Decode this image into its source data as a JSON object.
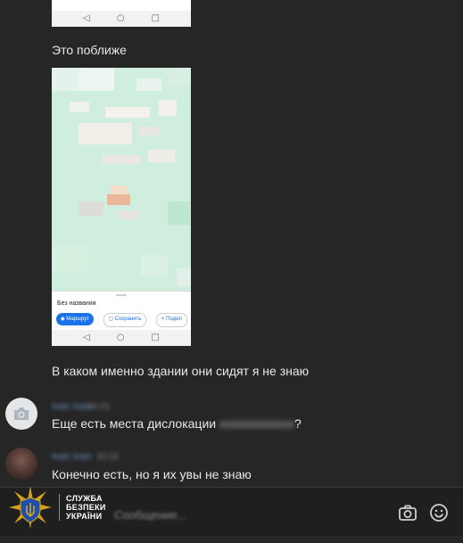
{
  "messages": {
    "nearby": "Это поближе",
    "building": "В каком именно здании они сидят я не знаю"
  },
  "map_screenshot": {
    "place_name": "Без названия",
    "route_button": "Маршрут",
    "save_button": "Сохранить",
    "share_button": "Подел",
    "nav_back": "◁",
    "nav_home": "○",
    "nav_recent": "□"
  },
  "replies": [
    {
      "sender": "Ivan Ivan",
      "time": "10:21",
      "text_before": "Еще есть места дислокации ",
      "redacted": "xxxxxxxxxxxx",
      "text_after": "?"
    },
    {
      "sender": "Ivan Ivan",
      "time": "10:22",
      "text": "Конечно есть, но я их увы не знаю"
    }
  ],
  "composer": {
    "placeholder": "Сообщение..."
  },
  "sbu_logo": {
    "line1": "СЛУЖБА",
    "line2": "БЕЗПЕКИ",
    "line3": "УКРАЇНИ"
  },
  "colors": {
    "background": "#262626",
    "sender_name": "#6b8fc7",
    "map_green": "#cfeedd",
    "route_blue": "#1a73e8",
    "sbu_gold": "#d4a21a",
    "sbu_blue": "#1f4fa8"
  },
  "icons": {
    "avatar_1": "camera-icon",
    "composer_camera": "camera-icon",
    "composer_emoji": "smiley-icon"
  }
}
